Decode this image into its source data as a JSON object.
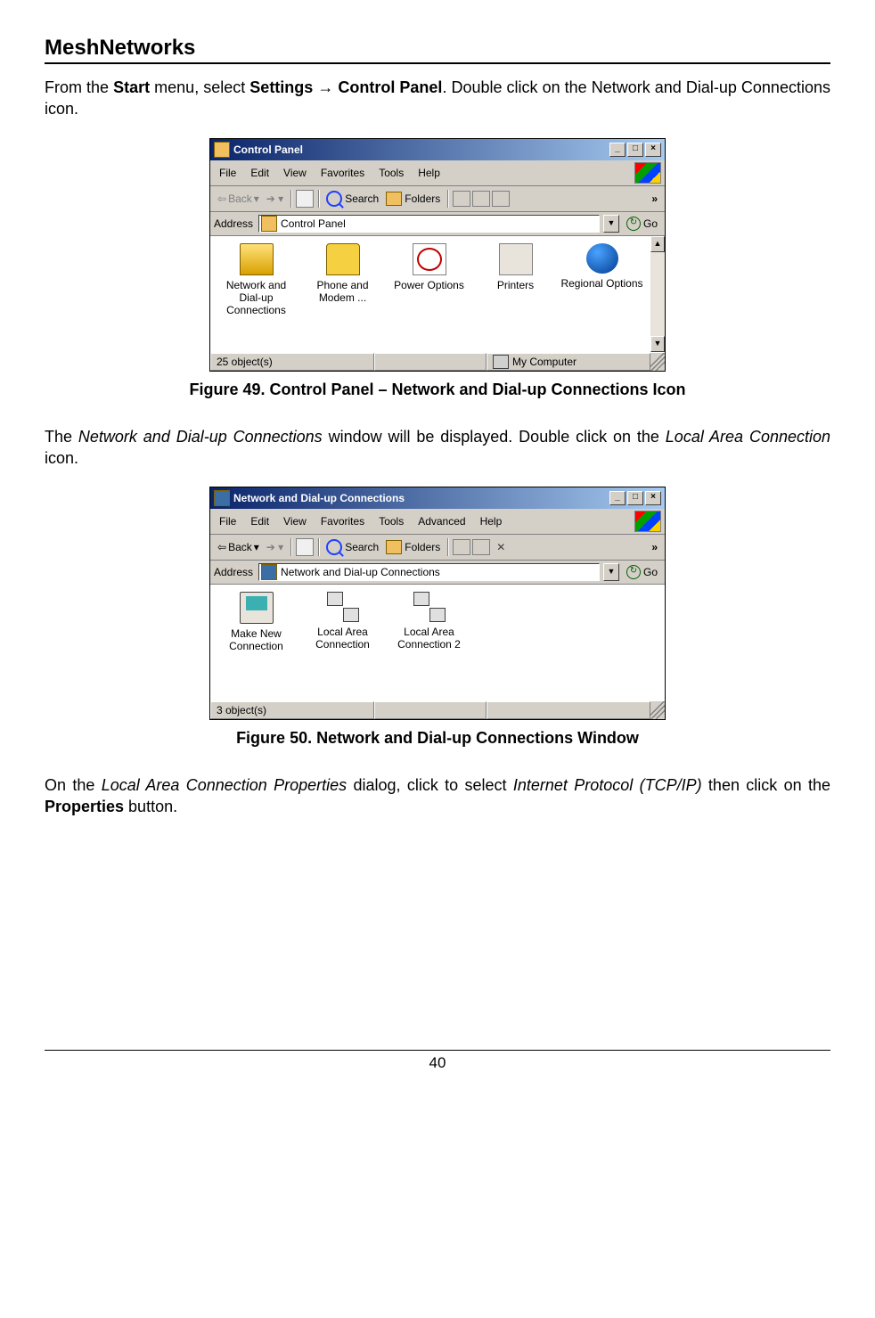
{
  "header": {
    "title": "MeshNetworks"
  },
  "para1": {
    "t1": "From the ",
    "b1": "Start",
    "t2": " menu, select ",
    "b2": "Settings ",
    "arrow": "→",
    "b3": " Control Panel",
    "t3": ".  Double click on the Network and Dial-up Connections icon."
  },
  "fig49": {
    "caption": "Figure 49.      Control Panel – Network and Dial-up Connections Icon"
  },
  "win1": {
    "title": "Control Panel",
    "menus": [
      "File",
      "Edit",
      "View",
      "Favorites",
      "Tools",
      "Help"
    ],
    "toolbar": {
      "back": "Back",
      "search": "Search",
      "folders": "Folders",
      "chev": "»"
    },
    "address": {
      "label": "Address",
      "value": "Control Panel",
      "go": "Go"
    },
    "icons": [
      {
        "label": "Network and Dial-up Connections"
      },
      {
        "label": "Phone and Modem ..."
      },
      {
        "label": "Power Options"
      },
      {
        "label": "Printers"
      },
      {
        "label": "Regional Options"
      }
    ],
    "status": {
      "left": "25 object(s)",
      "right": "My Computer"
    }
  },
  "para2": {
    "t1": "The ",
    "i1": "Network and Dial-up Connections",
    "t2": " window will be displayed.  Double click on the ",
    "i2": "Local Area Connection",
    "t3": " icon."
  },
  "fig50": {
    "caption": "Figure 50.      Network and Dial-up Connections Window"
  },
  "win2": {
    "title": "Network and Dial-up Connections",
    "menus": [
      "File",
      "Edit",
      "View",
      "Favorites",
      "Tools",
      "Advanced",
      "Help"
    ],
    "toolbar": {
      "back": "Back",
      "search": "Search",
      "folders": "Folders",
      "chev": "»"
    },
    "address": {
      "label": "Address",
      "value": "Network and Dial-up Connections",
      "go": "Go"
    },
    "icons": [
      {
        "label": "Make New Connection"
      },
      {
        "label": "Local Area Connection"
      },
      {
        "label": "Local Area Connection 2"
      }
    ],
    "status": {
      "left": "3 object(s)",
      "right": ""
    }
  },
  "para3": {
    "t1": "On the ",
    "i1": "Local Area Connection Properties",
    "t2": " dialog, click to select ",
    "i2": "Internet Protocol (TCP/IP)",
    "t3": " then click on the ",
    "b1": "Properties",
    "t4": " button."
  },
  "footer": {
    "page": "40"
  }
}
